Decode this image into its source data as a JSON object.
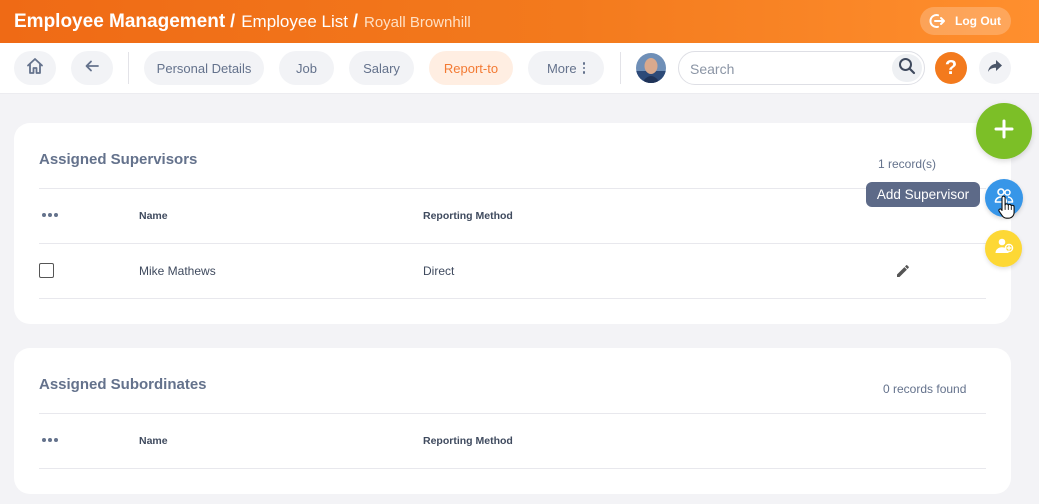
{
  "header": {
    "module": "Employee Management",
    "section": "Employee List",
    "current": "Royall Brownhill",
    "separator": "/",
    "logout_label": "Log Out"
  },
  "toolbar": {
    "tabs": [
      {
        "label": "Personal Details",
        "active": false
      },
      {
        "label": "Job",
        "active": false
      },
      {
        "label": "Salary",
        "active": false
      },
      {
        "label": "Report-to",
        "active": true
      },
      {
        "label": "More",
        "active": false
      }
    ],
    "search_placeholder": "Search",
    "help_label": "?"
  },
  "supervisors": {
    "title": "Assigned Supervisors",
    "count": "1 record(s)",
    "columns": [
      "Name",
      "Reporting Method"
    ],
    "rows": [
      {
        "name": "Mike Mathews",
        "method": "Direct"
      }
    ]
  },
  "subordinates": {
    "title": "Assigned Subordinates",
    "count": "0 records found",
    "columns": [
      "Name",
      "Reporting Method"
    ]
  },
  "fab": {
    "tooltip": "Add Supervisor"
  },
  "colors": {
    "brand_orange": "#f37a1d",
    "fab_green": "#7cbf27",
    "fab_blue": "#3796e8",
    "fab_yellow": "#fdd835",
    "active_tab_bg": "#ffeee2",
    "text_slate": "#64728c"
  },
  "icons": {
    "home": "home-icon",
    "back": "arrow-left-icon",
    "search": "search-icon",
    "share": "share-arrow-icon",
    "logout": "logout-icon",
    "row_menu": "more-horizontal-icon",
    "edit": "pencil-icon",
    "add": "plus-icon",
    "add_supervisor": "users-icon",
    "add_subordinate": "user-add-icon"
  }
}
